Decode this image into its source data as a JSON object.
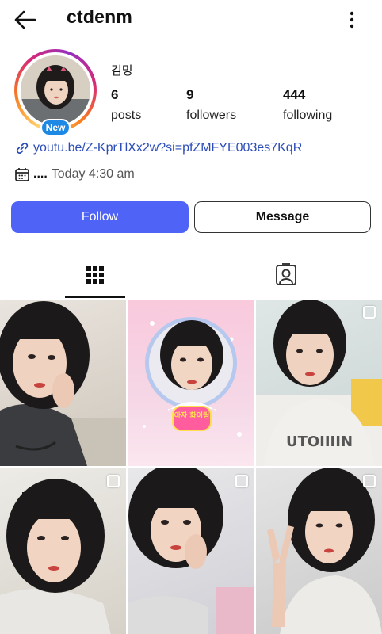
{
  "header": {
    "username": "ctdenm",
    "back_icon": "arrow-left-icon",
    "more_icon": "more-vertical-icon"
  },
  "profile": {
    "display_name": "김밍",
    "new_badge": "New",
    "stats": [
      {
        "value": "6",
        "label": "posts"
      },
      {
        "value": "9",
        "label": "followers"
      },
      {
        "value": "444",
        "label": "following"
      }
    ],
    "link": "youtu.be/Z-KprTlXx2w?si=pfZMFYE003es7KqR",
    "date_dots": "....",
    "date_text": "Today 4:30 am"
  },
  "actions": {
    "follow_label": "Follow",
    "message_label": "Message"
  },
  "tabs": [
    {
      "icon": "grid-icon",
      "active": true
    },
    {
      "icon": "tagged-person-icon",
      "active": false
    }
  ],
  "posts": [
    {
      "multi": false
    },
    {
      "multi": false,
      "sticker_text": "아자 화이팅"
    },
    {
      "multi": true
    },
    {
      "multi": true
    },
    {
      "multi": true
    },
    {
      "multi": true
    }
  ],
  "colors": {
    "follow_button": "#4f63f6",
    "link": "#2c4db8",
    "new_badge": "#1e88e5"
  }
}
